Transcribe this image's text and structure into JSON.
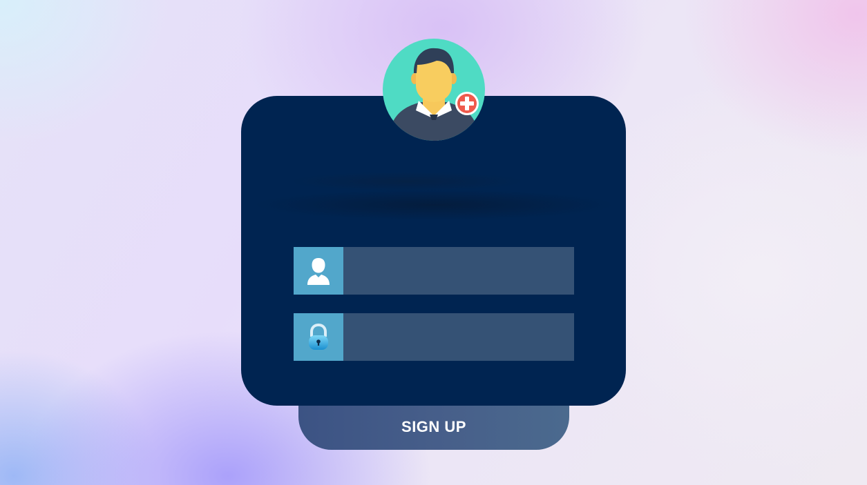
{
  "form": {
    "username": {
      "value": "",
      "placeholder": "",
      "icon": "user-icon"
    },
    "password": {
      "value": "",
      "placeholder": "",
      "icon": "lock-icon"
    },
    "avatar_icon": "add-user-avatar-icon",
    "submit_label": "SIGN UP"
  },
  "colors": {
    "card": "#002451",
    "field_bg": "#355275",
    "icon_box": "#52a7cb",
    "button": "#475f8a",
    "avatar_bg": "#4fdbc4"
  }
}
